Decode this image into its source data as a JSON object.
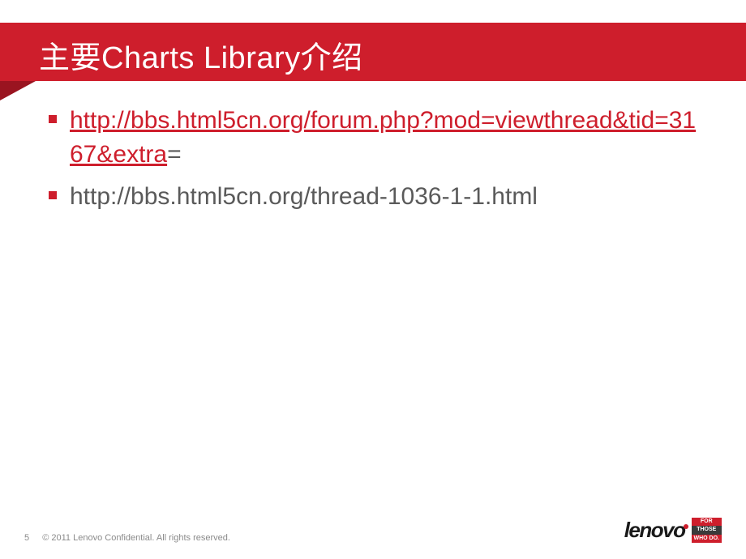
{
  "header": {
    "title": "主要Charts Library介绍"
  },
  "bullets": [
    {
      "link_text": "http://bbs.html5cn.org/forum.php?mod=viewthread&tid=3167&extra",
      "trailing": "="
    },
    {
      "text": "http://bbs.html5cn.org/thread-1036-1-1.html"
    }
  ],
  "footer": {
    "page_number": "5",
    "copyright": "  © 2011 Lenovo Confidential. All rights reserved.",
    "logo_text": "lenovo",
    "tagline": {
      "line1": "FOR",
      "line2": "THOSE",
      "line3": "WHO DO."
    }
  }
}
